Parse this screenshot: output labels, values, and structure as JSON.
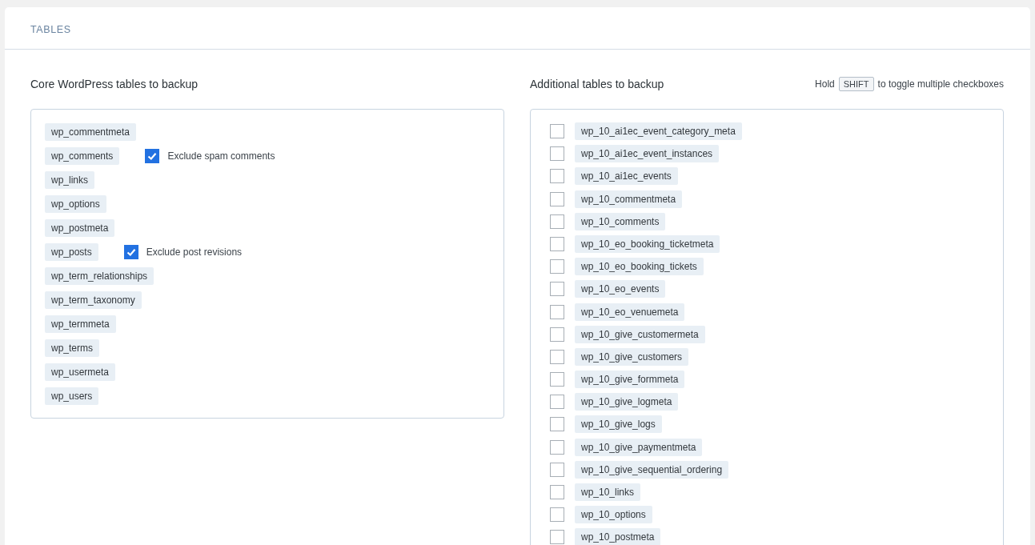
{
  "section": {
    "title": "TABLES"
  },
  "core": {
    "heading": "Core WordPress tables to backup",
    "tables": [
      {
        "name": "wp_commentmeta"
      },
      {
        "name": "wp_comments",
        "option": {
          "label": "Exclude spam comments",
          "checked": true
        }
      },
      {
        "name": "wp_links"
      },
      {
        "name": "wp_options"
      },
      {
        "name": "wp_postmeta"
      },
      {
        "name": "wp_posts",
        "option": {
          "label": "Exclude post revisions",
          "checked": true
        }
      },
      {
        "name": "wp_term_relationships"
      },
      {
        "name": "wp_term_taxonomy"
      },
      {
        "name": "wp_termmeta"
      },
      {
        "name": "wp_terms"
      },
      {
        "name": "wp_usermeta"
      },
      {
        "name": "wp_users"
      }
    ]
  },
  "additional": {
    "heading": "Additional tables to backup",
    "hint": {
      "before": "Hold",
      "key": "SHIFT",
      "after": "to toggle multiple checkboxes"
    },
    "tables": [
      {
        "name": "wp_10_ai1ec_event_category_meta",
        "checked": false
      },
      {
        "name": "wp_10_ai1ec_event_instances",
        "checked": false
      },
      {
        "name": "wp_10_ai1ec_events",
        "checked": false
      },
      {
        "name": "wp_10_commentmeta",
        "checked": false
      },
      {
        "name": "wp_10_comments",
        "checked": false
      },
      {
        "name": "wp_10_eo_booking_ticketmeta",
        "checked": false
      },
      {
        "name": "wp_10_eo_booking_tickets",
        "checked": false
      },
      {
        "name": "wp_10_eo_events",
        "checked": false
      },
      {
        "name": "wp_10_eo_venuemeta",
        "checked": false
      },
      {
        "name": "wp_10_give_customermeta",
        "checked": false
      },
      {
        "name": "wp_10_give_customers",
        "checked": false
      },
      {
        "name": "wp_10_give_formmeta",
        "checked": false
      },
      {
        "name": "wp_10_give_logmeta",
        "checked": false
      },
      {
        "name": "wp_10_give_logs",
        "checked": false
      },
      {
        "name": "wp_10_give_paymentmeta",
        "checked": false
      },
      {
        "name": "wp_10_give_sequential_ordering",
        "checked": false
      },
      {
        "name": "wp_10_links",
        "checked": false
      },
      {
        "name": "wp_10_options",
        "checked": false
      },
      {
        "name": "wp_10_postmeta",
        "checked": false
      }
    ]
  }
}
